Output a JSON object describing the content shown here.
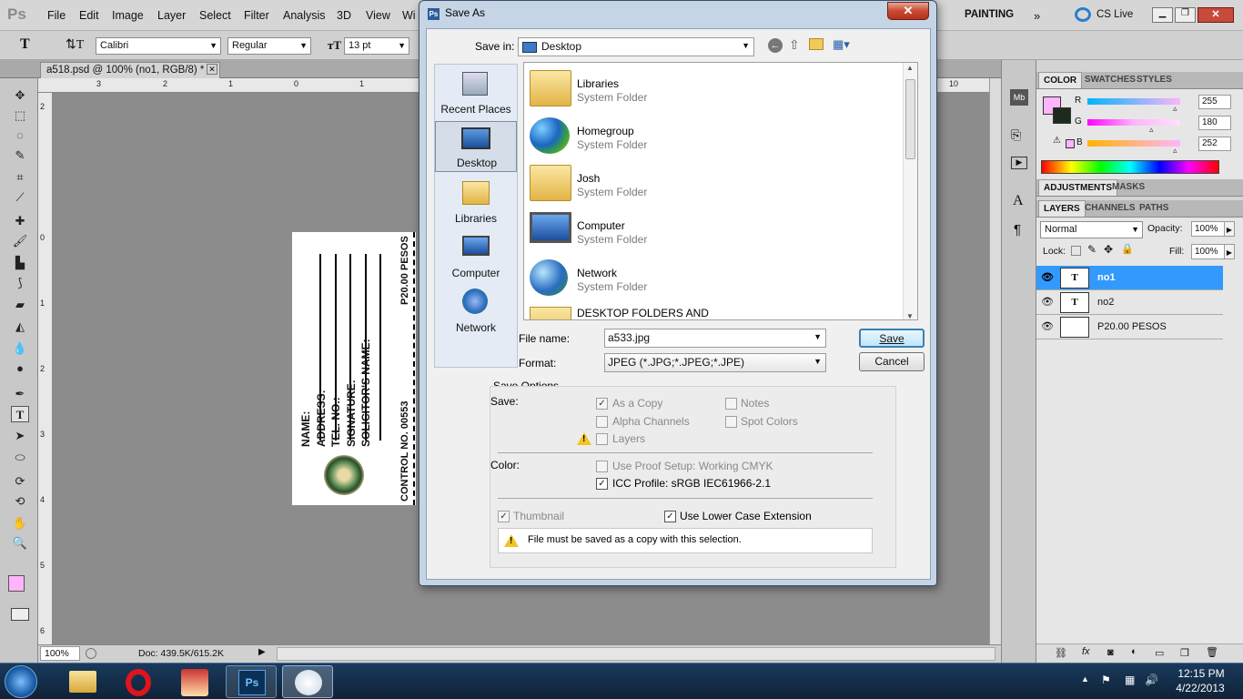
{
  "app": {
    "menu": [
      "File",
      "Edit",
      "Image",
      "Layer",
      "Select",
      "Filter",
      "Analysis",
      "3D",
      "View",
      "Wi"
    ],
    "workspace": "PAINTING",
    "cs_live": "CS Live",
    "options": {
      "font_family": "Calibri",
      "font_style": "Regular",
      "font_size": "13 pt"
    },
    "doc_tab": "a518.psd @ 100% (no1, RGB/8) *",
    "ruler_top": [
      "3",
      "2",
      "1",
      "0",
      "1",
      "10"
    ],
    "ruler_left": [
      "2",
      "0",
      "1",
      "2",
      "3",
      "4",
      "5",
      "6"
    ],
    "zoom": "100%",
    "doc_info": "Doc: 439.5K/615.2K"
  },
  "document": {
    "lines": [
      "NAME:",
      "ADDRESS:",
      "TEL. NO.:",
      "SIGNATURE:",
      "SOLICITOR'S NAME:"
    ],
    "price": "P20.00 PESOS",
    "control": "CONTROL NO. 00553"
  },
  "panels": {
    "color_tabs": [
      "COLOR",
      "SWATCHES",
      "STYLES"
    ],
    "rgb": [
      {
        "label": "R",
        "value": "255",
        "pct": 1.0
      },
      {
        "label": "G",
        "value": "180",
        "pct": 0.706
      },
      {
        "label": "B",
        "value": "252",
        "pct": 0.988
      }
    ],
    "adj_tabs": [
      "ADJUSTMENTS",
      "MASKS"
    ],
    "layer_tabs": [
      "LAYERS",
      "CHANNELS",
      "PATHS"
    ],
    "blend": "Normal",
    "opacity_label": "Opacity:",
    "opacity": "100%",
    "lock_label": "Lock:",
    "fill_label": "Fill:",
    "fill": "100%",
    "layers": [
      {
        "name": "no1",
        "type": "T",
        "selected": true
      },
      {
        "name": "no2",
        "type": "T",
        "selected": false
      },
      {
        "name": "P20.00 PESOS",
        "type": "img",
        "selected": false
      }
    ],
    "colors": {
      "foreground": "#ffb4fc",
      "accent": "#3399ff"
    }
  },
  "taskbar": {
    "time": "12:15 PM",
    "date": "4/22/2013"
  },
  "dialog": {
    "title": "Save As",
    "save_in_label": "Save in:",
    "save_in_value": "Desktop",
    "places": [
      "Recent Places",
      "Desktop",
      "Libraries",
      "Computer",
      "Network"
    ],
    "files": [
      {
        "name": "Libraries",
        "type": "System Folder"
      },
      {
        "name": "Homegroup",
        "type": "System Folder"
      },
      {
        "name": "Josh",
        "type": "System Folder"
      },
      {
        "name": "Computer",
        "type": "System Folder"
      },
      {
        "name": "Network",
        "type": "System Folder"
      },
      {
        "name": "DESKTOP FOLDERS AND",
        "type": ""
      }
    ],
    "filename_label": "File name:",
    "filename_value": "a533.jpg",
    "format_label": "Format:",
    "format_value": "JPEG (*.JPG;*.JPEG;*.JPE)",
    "save_button": "Save",
    "cancel_button": "Cancel",
    "save_options_title": "Save Options",
    "save_label": "Save:",
    "as_copy": "As a Copy",
    "notes": "Notes",
    "alpha": "Alpha Channels",
    "spot": "Spot Colors",
    "layers": "Layers",
    "color_label": "Color:",
    "proof": "Use Proof Setup:  Working CMYK",
    "icc": "ICC Profile:  sRGB IEC61966-2.1",
    "thumbnail": "Thumbnail",
    "lowercase": "Use Lower Case Extension",
    "warning": "File must be saved as a copy with this selection."
  }
}
